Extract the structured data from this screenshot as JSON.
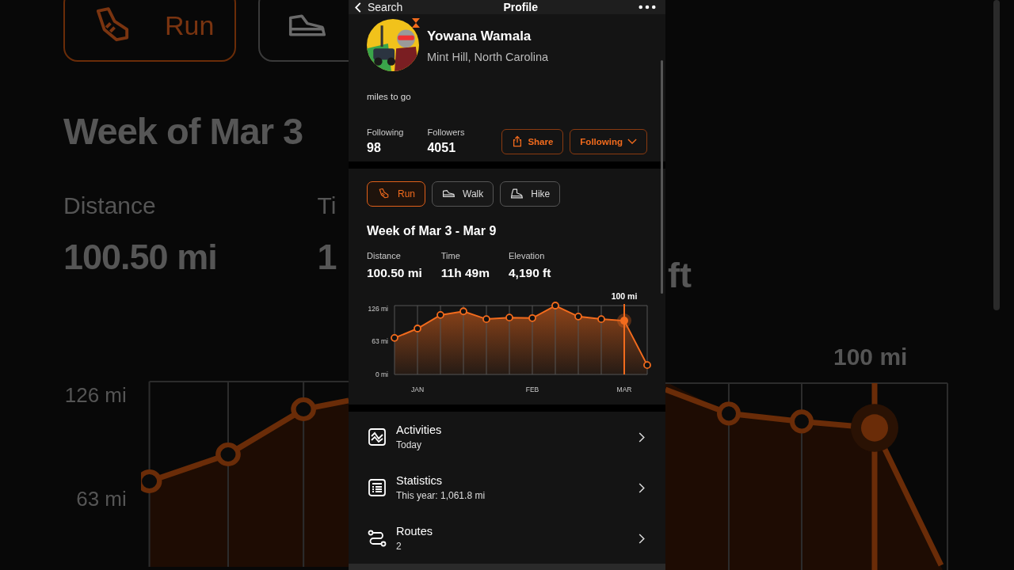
{
  "header": {
    "back": "Search",
    "title": "Profile"
  },
  "profile": {
    "name": "Yowana Wamala",
    "location": "Mint Hill, North Carolina",
    "bio": "miles to go",
    "stats": [
      {
        "label": "Following",
        "value": "98"
      },
      {
        "label": "Followers",
        "value": "4051"
      }
    ],
    "buttons": [
      {
        "kind": "share",
        "label": "Share"
      },
      {
        "kind": "dropdown",
        "label": "Following"
      }
    ]
  },
  "activity": {
    "tabs": [
      {
        "kind": "run",
        "label": "Run",
        "selected": true
      },
      {
        "kind": "walk",
        "label": "Walk",
        "selected": false
      },
      {
        "kind": "hike",
        "label": "Hike",
        "selected": false
      }
    ],
    "title": "Week of Mar 3 - Mar 9",
    "stats": [
      {
        "label": "Distance",
        "value": "100.50 mi"
      },
      {
        "label": "Time",
        "value": "11h 49m"
      },
      {
        "label": "Elevation",
        "value": "4,190 ft"
      }
    ],
    "chart_data": {
      "type": "area",
      "categories": [
        null,
        "JAN",
        null,
        null,
        null,
        null,
        "FEB",
        null,
        null,
        null,
        "MAR",
        null
      ],
      "series": [
        {
          "color": "#f26b1d",
          "values": [
            70,
            88,
            114,
            121,
            106,
            109,
            108,
            132,
            111,
            106,
            103,
            18
          ]
        }
      ],
      "ylim": [
        0,
        132
      ],
      "grid": true,
      "yticks": [
        {
          "value": 0,
          "label": "0 mi"
        },
        {
          "value": 63,
          "label": "63 mi"
        },
        {
          "value": 126,
          "label": "126 mi"
        }
      ],
      "annotations": [
        {
          "x": "MAR",
          "y": 103,
          "text": "100 mi"
        }
      ]
    }
  },
  "menu": [
    {
      "kind": "activities",
      "title": "Activities",
      "subtitle": "Today"
    },
    {
      "kind": "statistics",
      "title": "Statistics",
      "subtitle": "This year: 1,061.8 mi"
    },
    {
      "kind": "routes",
      "title": "Routes",
      "subtitle": "2"
    }
  ],
  "backdrop": {
    "left": {
      "tabs": [
        {
          "kind": "run",
          "label": "Run",
          "selected": true
        },
        {
          "kind": "walk",
          "selected": false
        }
      ],
      "title": "Week of Mar 3",
      "stats": [
        {
          "label": "Distance",
          "value": "100.50 mi"
        },
        {
          "label": "Ti",
          "value": "1"
        }
      ],
      "yticks": [
        "126 mi",
        "63 mi"
      ]
    },
    "right": {
      "value": "ft",
      "annotation": "100 mi"
    }
  }
}
